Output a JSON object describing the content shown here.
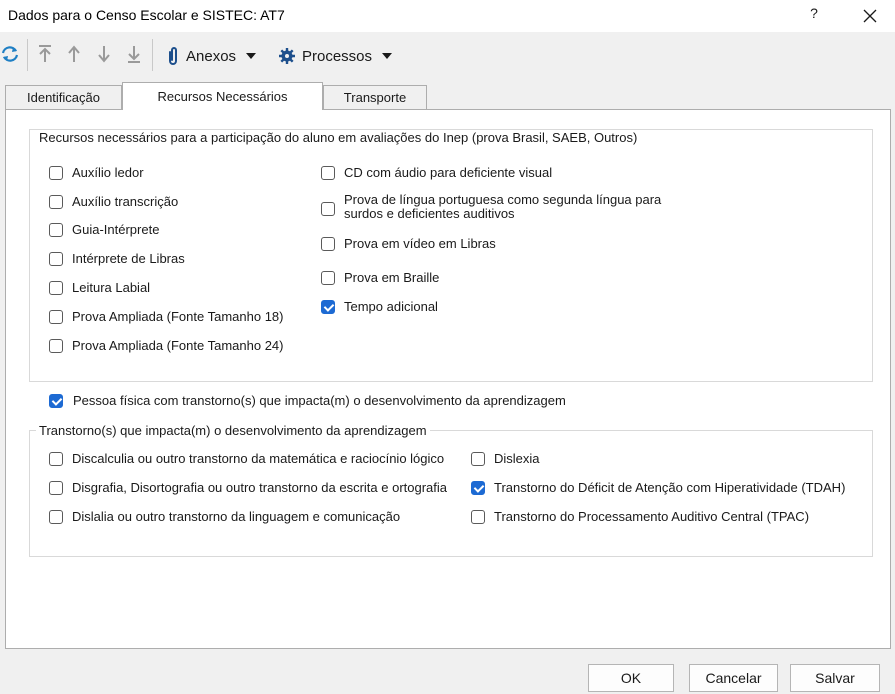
{
  "window": {
    "title": "Dados para o Censo Escolar e SISTEC: AT7",
    "help_label": "?",
    "close_icon": "close-icon"
  },
  "toolbar": {
    "refresh_icon": "refresh-icon",
    "move_top_icon": "arrow-to-top-icon",
    "move_up_icon": "arrow-up-icon",
    "move_down_icon": "arrow-down-icon",
    "move_bottom_icon": "arrow-to-bottom-icon",
    "anexos_label": "Anexos",
    "processos_label": "Processos"
  },
  "tabs": [
    {
      "label": "Identificação",
      "active": false
    },
    {
      "label": "Recursos Necessários",
      "active": true
    },
    {
      "label": "Transporte",
      "active": false
    }
  ],
  "recursos": {
    "title": "Recursos necessários para a participação do aluno em avaliações do Inep (prova Brasil, SAEB, Outros)",
    "left_items": [
      {
        "label": "Auxílio ledor",
        "checked": false
      },
      {
        "label": "Auxílio transcrição",
        "checked": false
      },
      {
        "label": "Guia-Intérprete",
        "checked": false
      },
      {
        "label": "Intérprete de Libras",
        "checked": false
      },
      {
        "label": "Leitura Labial",
        "checked": false
      },
      {
        "label": "Prova Ampliada (Fonte Tamanho 18)",
        "checked": false
      },
      {
        "label": "Prova Ampliada (Fonte Tamanho 24)",
        "checked": false
      }
    ],
    "right_items": [
      {
        "label": "CD com áudio para deficiente visual",
        "checked": false
      },
      {
        "label": "Prova de língua portuguesa como segunda língua para surdos e deficientes auditivos",
        "checked": false
      },
      {
        "label": "Prova em vídeo em Libras",
        "checked": false
      },
      {
        "label": "Prova em Braille",
        "checked": false
      },
      {
        "label": "Tempo adicional",
        "checked": true
      }
    ]
  },
  "pessoa": {
    "label": "Pessoa física com transtorno(s) que impacta(m) o desenvolvimento da aprendizagem",
    "checked": true
  },
  "transtornos": {
    "title": "Transtorno(s) que impacta(m) o desenvolvimento da aprendizagem",
    "left_items": [
      {
        "label": "Discalculia ou outro transtorno da matemática e raciocínio lógico",
        "checked": false
      },
      {
        "label": "Disgrafia, Disortografia ou outro transtorno da escrita e ortografia",
        "checked": false
      },
      {
        "label": "Dislalia ou outro transtorno da linguagem e comunicação",
        "checked": false
      }
    ],
    "right_items": [
      {
        "label": "Dislexia",
        "checked": false
      },
      {
        "label": "Transtorno do Déficit de Atenção com Hiperatividade (TDAH)",
        "checked": true
      },
      {
        "label": "Transtorno do Processamento Auditivo Central (TPAC)",
        "checked": false
      }
    ]
  },
  "buttons": {
    "ok": "OK",
    "cancel": "Cancelar",
    "save": "Salvar"
  }
}
